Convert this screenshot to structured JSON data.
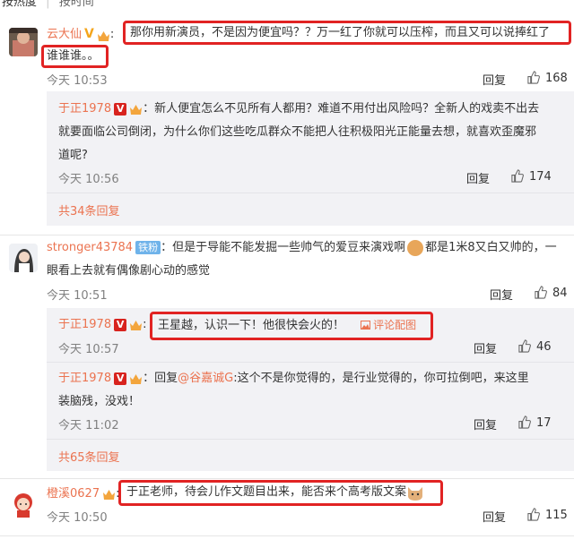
{
  "top_tabs": {
    "hot": "按热度",
    "time": "按时间"
  },
  "comments": [
    {
      "user": "云大仙",
      "text_boxed": "那你用新演员，不是因为便宜吗？？万一红了你就可以压榨，而且又可以说捧红了",
      "text_boxed_line2": "谁谁谁。。",
      "time": "今天 10:53",
      "reply_label": "回复",
      "likes": "168",
      "replies": [
        {
          "user": "于正1978",
          "text_line1": "：新人便宜怎么不见所有人都用？难道不用付出风险吗？全新人的戏卖不出去",
          "text_line2": "就要面临公司倒闭，为什么你们这些吃瓜群众不能把人往积极阳光正能量去想，就喜欢歪魔邪",
          "text_line3": "道呢?",
          "time": "今天 10:56",
          "reply_label": "回复",
          "likes": "174"
        }
      ],
      "more": "共34条回复"
    },
    {
      "user": "stronger43784",
      "fan_badge": "铁粉",
      "text_line1a": "：但是于导能不能发掘一些帅气的爱豆来演戏啊",
      "text_line1b": "都是1米8又白又帅的，一",
      "text_line2": "眼看上去就有偶像剧心动的感觉",
      "time": "今天 10:51",
      "reply_label": "回复",
      "likes": "84",
      "replies": [
        {
          "user": "于正1978",
          "text_boxed": "王星越，认识一下！他很快会火的！",
          "pic_link": "评论配图",
          "time": "今天 10:57",
          "reply_label": "回复",
          "likes": "46"
        },
        {
          "user": "于正1978",
          "text_prefix": "：回复",
          "mention": "@谷嘉诚G",
          "text_line1": ":这个不是你觉得的，是行业觉得的，你可拉倒吧，来这里",
          "text_line2": "装脑残，没戏！",
          "time": "今天 11:02",
          "reply_label": "回复",
          "likes": "17"
        }
      ],
      "more": "共65条回复"
    },
    {
      "user": "橙溪0627",
      "text_boxed": "于正老师，待会儿作文题目出来，能否来个高考版文案",
      "time": "今天 10:50",
      "reply_label": "回复",
      "likes": "115"
    }
  ],
  "colors": {
    "accent": "#eb7350",
    "highlight_box": "#e12323",
    "reply_bg": "#f2f2f5",
    "vip_gold": "#f4a51c",
    "vip_red": "#d8231e"
  }
}
